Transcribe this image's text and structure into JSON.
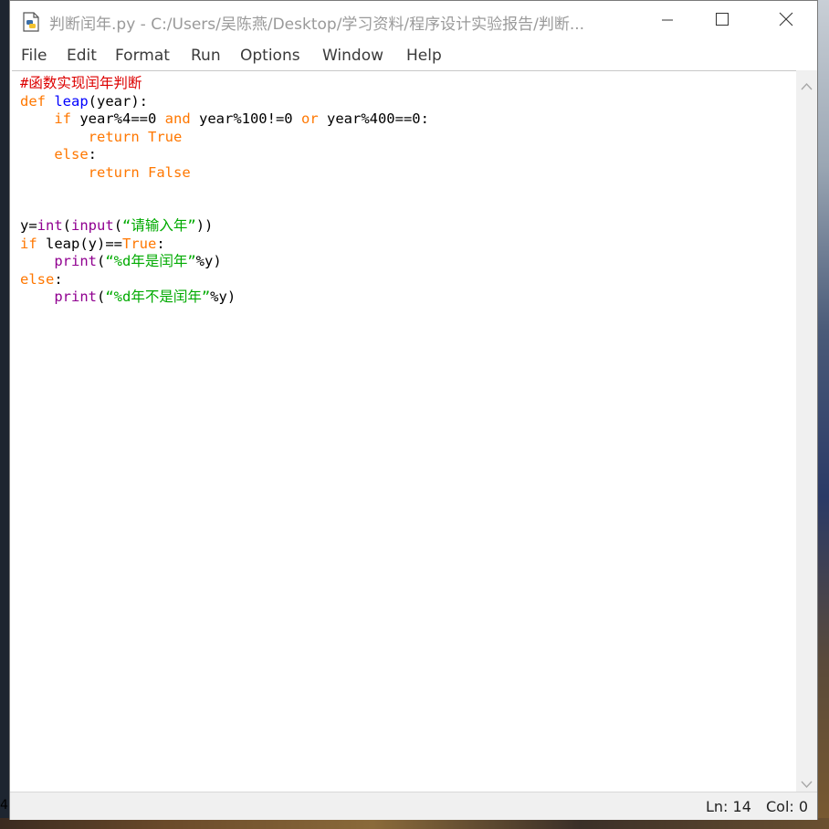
{
  "window": {
    "title": "判断闰年.py - C:/Users/吴陈燕/Desktop/学习资料/程序设计实验报告/判断..."
  },
  "menu": [
    "File",
    "Edit",
    "Format",
    "Run",
    "Options",
    "Window",
    "Help"
  ],
  "code": {
    "line1_comment": "#函数实现闰年判断",
    "line2_def": "def",
    "line2_fn": "leap",
    "line2_rest": "(year):",
    "line3_if": "if",
    "line3_a": " year%4==0 ",
    "line3_and": "and",
    "line3_b": " year%100!=0 ",
    "line3_or": "or",
    "line3_c": " year%400==0:",
    "line4_return": "return",
    "line4_true": "True",
    "line5_else": "else",
    "line5_colon": ":",
    "line6_return": "return",
    "line6_false": "False",
    "line9_y": "y=",
    "line9_int": "int",
    "line9_paren": "(",
    "line9_input": "input",
    "line9_paren2": "(",
    "line9_str": "“请输入年”",
    "line9_close": "))",
    "line10_if": "if",
    "line10_mid": " leap(y)==",
    "line10_true": "True",
    "line10_colon": ":",
    "line11_print": "print",
    "line11_paren": "(",
    "line11_str": "“%d年是闰年”",
    "line11_rest": "%y)",
    "line12_else": "else",
    "line12_colon": ":",
    "line13_print": "print",
    "line13_paren": "(",
    "line13_str": "“%d年不是闰年”",
    "line13_rest": "%y)"
  },
  "status": {
    "ln": "Ln: 14",
    "col": "Col: 0",
    "left_edge": "4"
  },
  "colors": {
    "keyword": "#ff7700",
    "builtin": "#900090",
    "string": "#00aa00",
    "comment": "#dd0000",
    "function_name": "#0000ff"
  },
  "icons": [
    "python-file-icon",
    "minimize-icon",
    "maximize-icon",
    "close-icon",
    "scroll-up-icon",
    "scroll-down-icon"
  ]
}
